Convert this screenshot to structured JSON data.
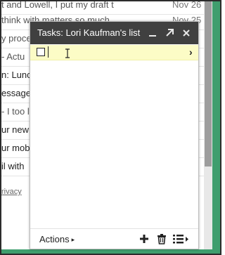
{
  "background_mail": {
    "rows": [
      {
        "text": "t and Lowell, I put my draft t",
        "date": "Nov 26",
        "unread": false
      },
      {
        "text": "think with matters so much",
        "date": "Nov 25",
        "unread": false
      },
      {
        "text": "y proce",
        "date": "",
        "unread": false
      },
      {
        "text": "- Actu",
        "date": "",
        "unread": false
      },
      {
        "text": "n: Lunc",
        "date": "",
        "unread": true
      },
      {
        "text": "essage",
        "date": "",
        "unread": true
      },
      {
        "text": "- I too l",
        "date": "",
        "unread": false
      },
      {
        "text": "ur new",
        "date": "",
        "unread": true
      },
      {
        "text": "ur mob",
        "date": "",
        "unread": true
      },
      {
        "text": "il with",
        "date": "",
        "unread": true
      }
    ],
    "privacy_link": "rivacy"
  },
  "tasks_window": {
    "title": "Tasks: Lori Kaufman's list",
    "minimize_icon": "minimize-icon",
    "popout_icon": "expand-arrow-icon",
    "close_icon": "close-icon",
    "new_task": {
      "value": "",
      "placeholder": ""
    },
    "footer": {
      "actions_label": "Actions",
      "actions_caret": "▸",
      "add_icon": "plus-icon",
      "delete_icon": "trash-icon",
      "lists_icon": "list-icon"
    }
  },
  "colors": {
    "titlebar": "#404040",
    "task_highlight": "#fcfcc6",
    "frame_accent": "#3f9e6e"
  }
}
